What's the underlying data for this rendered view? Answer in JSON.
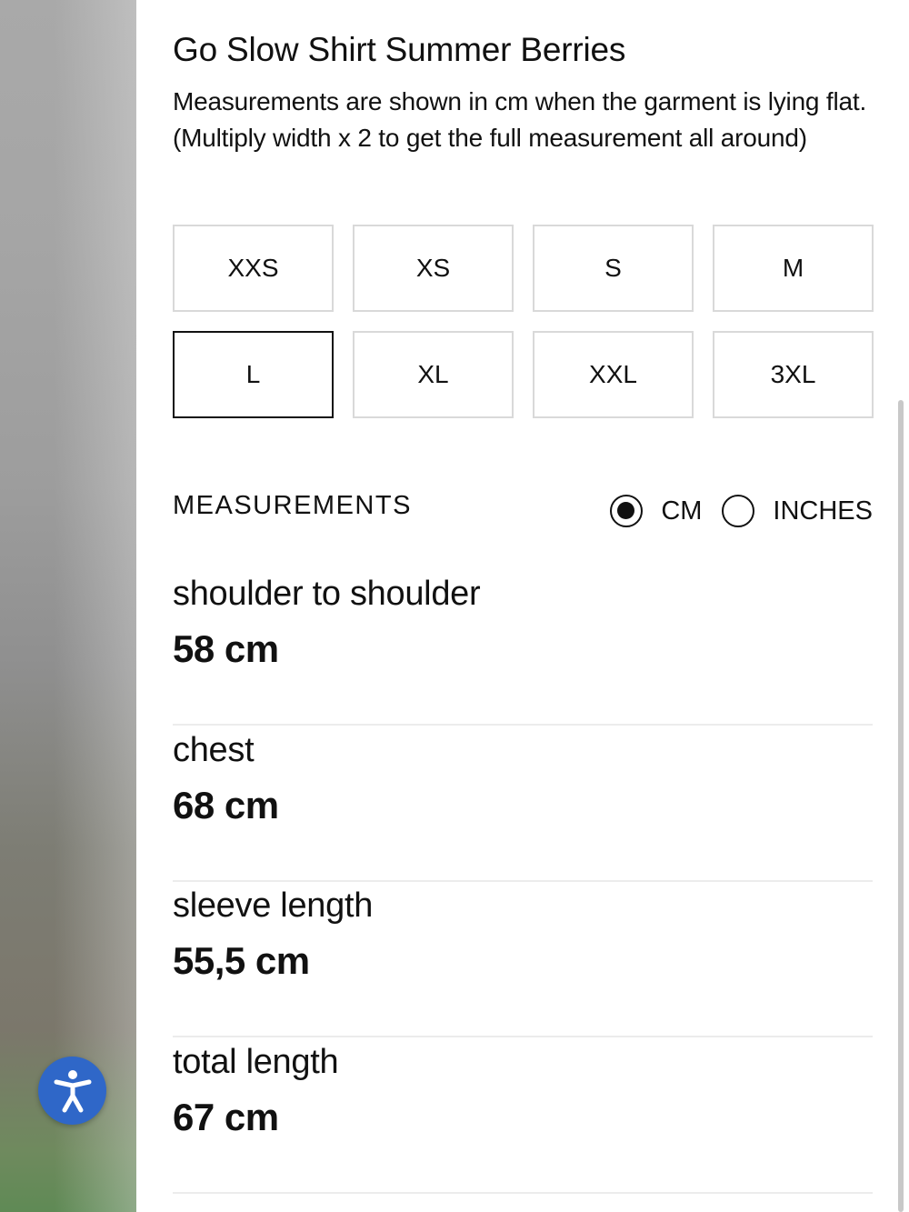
{
  "product": {
    "title": "Go Slow Shirt Summer Berries",
    "description": "Measurements are shown in cm when the garment is lying flat. (Multiply width x 2 to get the full measurement all around)"
  },
  "sizes": {
    "options": [
      "XXS",
      "XS",
      "S",
      "M",
      "L",
      "XL",
      "XXL",
      "3XL"
    ],
    "selected": "L"
  },
  "measurements": {
    "header": "MEASUREMENTS",
    "units": {
      "cm_label": "CM",
      "inches_label": "INCHES",
      "selected": "CM"
    },
    "rows": [
      {
        "label": "shoulder to shoulder",
        "value": "58 cm"
      },
      {
        "label": "chest",
        "value": "68 cm"
      },
      {
        "label": "sleeve length",
        "value": "55,5 cm"
      },
      {
        "label": "total length",
        "value": "67 cm"
      }
    ]
  },
  "accessibility_button": {
    "icon": "accessibility-icon",
    "color": "#2f67c8"
  }
}
